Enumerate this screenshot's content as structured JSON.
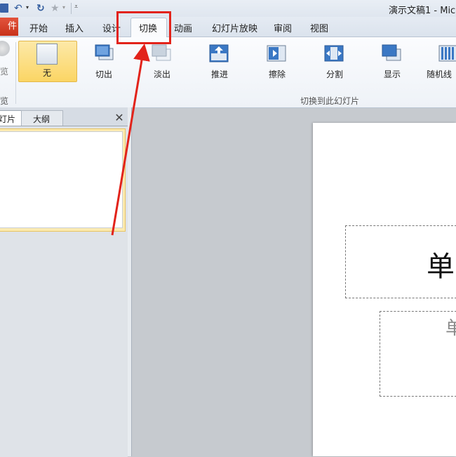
{
  "window": {
    "title": "演示文稿1 - Micr"
  },
  "file_tab_label": "件",
  "tabs": [
    {
      "label": "开始"
    },
    {
      "label": "插入"
    },
    {
      "label": "设计"
    },
    {
      "label": "切换"
    },
    {
      "label": "动画"
    },
    {
      "label": "幻灯片放映"
    },
    {
      "label": "审阅"
    },
    {
      "label": "视图"
    }
  ],
  "active_tab": "切换",
  "ribbon": {
    "preview_label": "览",
    "preview_group_label": "览",
    "transitions": [
      {
        "label": "无",
        "icon": "transition-none-icon",
        "selected": true
      },
      {
        "label": "切出",
        "icon": "transition-cut-icon"
      },
      {
        "label": "淡出",
        "icon": "transition-fade-icon"
      },
      {
        "label": "推进",
        "icon": "transition-push-icon"
      },
      {
        "label": "擦除",
        "icon": "transition-wipe-icon"
      },
      {
        "label": "分割",
        "icon": "transition-split-icon"
      },
      {
        "label": "显示",
        "icon": "transition-reveal-icon"
      },
      {
        "label": "随机线",
        "icon": "transition-random-bars-icon"
      }
    ],
    "group_label": "切换到此幻灯片"
  },
  "pane": {
    "tab_slides": "灯片",
    "tab_outline": "大纲",
    "close": "✕"
  },
  "slide": {
    "title_text": "单",
    "subtitle_text": "单"
  },
  "colors": {
    "highlight": "#e2231a",
    "selected_button": "#fbd564"
  }
}
